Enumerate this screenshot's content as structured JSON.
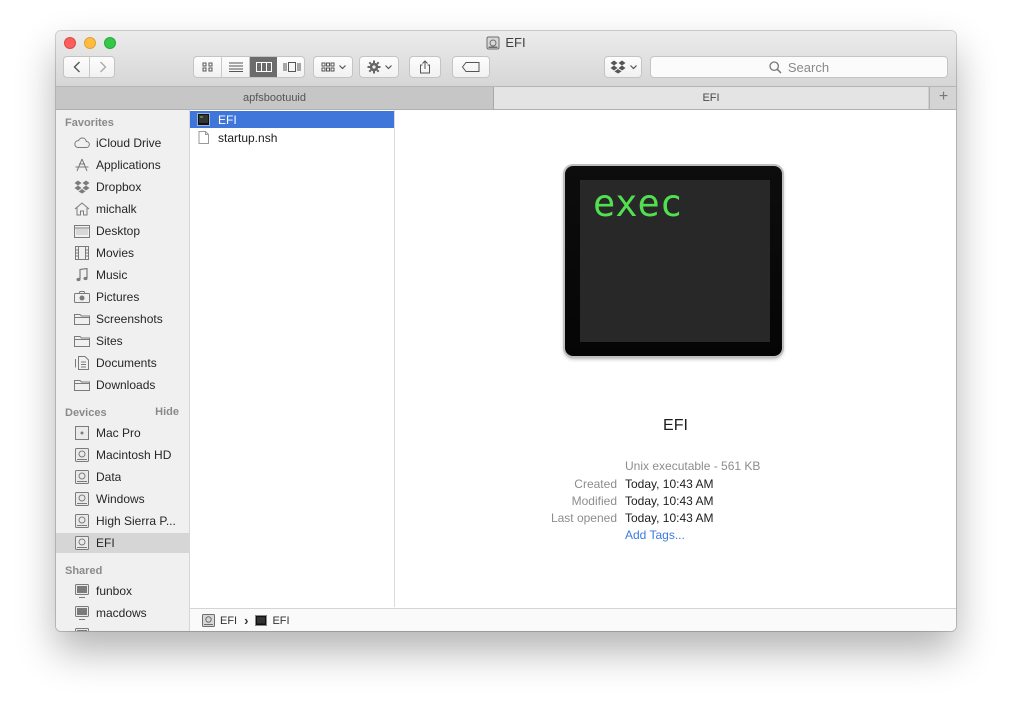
{
  "window": {
    "title": "EFI"
  },
  "toolbar": {
    "search_placeholder": "Search"
  },
  "tabs": [
    {
      "label": "apfsbootuuid"
    },
    {
      "label": "EFI"
    }
  ],
  "tab_add_label": "+",
  "sidebar": {
    "favorites_header": "Favorites",
    "favorites": [
      {
        "label": "iCloud Drive",
        "icon": "cloud-icon"
      },
      {
        "label": "Applications",
        "icon": "applications-icon"
      },
      {
        "label": "Dropbox",
        "icon": "dropbox-icon"
      },
      {
        "label": "michalk",
        "icon": "home-icon"
      },
      {
        "label": "Desktop",
        "icon": "desktop-icon"
      },
      {
        "label": "Movies",
        "icon": "movies-icon"
      },
      {
        "label": "Music",
        "icon": "music-icon"
      },
      {
        "label": "Pictures",
        "icon": "camera-icon"
      },
      {
        "label": "Screenshots",
        "icon": "folder-icon"
      },
      {
        "label": "Sites",
        "icon": "folder-icon"
      },
      {
        "label": "Documents",
        "icon": "documents-icon"
      },
      {
        "label": "Downloads",
        "icon": "folder-icon"
      }
    ],
    "devices_header": "Devices",
    "devices_hide": "Hide",
    "devices": [
      {
        "label": "Mac Pro",
        "icon": "computer-icon"
      },
      {
        "label": "Macintosh HD",
        "icon": "disk-icon"
      },
      {
        "label": "Data",
        "icon": "disk-icon"
      },
      {
        "label": "Windows",
        "icon": "disk-icon"
      },
      {
        "label": "High Sierra P...",
        "icon": "disk-icon"
      },
      {
        "label": "EFI",
        "icon": "disk-icon",
        "selected": true
      }
    ],
    "shared_header": "Shared",
    "shared": [
      {
        "label": "funbox",
        "icon": "monitor-icon"
      },
      {
        "label": "macdows",
        "icon": "monitor-icon"
      }
    ]
  },
  "column": {
    "items": [
      {
        "name": "EFI",
        "icon": "terminal-exec-icon",
        "selected": true
      },
      {
        "name": "startup.nsh",
        "icon": "document-icon",
        "selected": false
      }
    ]
  },
  "preview": {
    "icon_text": "exec",
    "name": "EFI",
    "kind": "Unix executable - 561 KB",
    "created_label": "Created",
    "created_value": "Today, 10:43 AM",
    "modified_label": "Modified",
    "modified_value": "Today, 10:43 AM",
    "opened_label": "Last opened",
    "opened_value": "Today, 10:43 AM",
    "tags_link": "Add Tags..."
  },
  "pathbar": {
    "segments": [
      "EFI",
      "EFI"
    ],
    "separator": "›"
  },
  "colors": {
    "selection_blue": "#3f76d9",
    "link_blue": "#3a7adf",
    "exec_green": "#51e04f"
  }
}
